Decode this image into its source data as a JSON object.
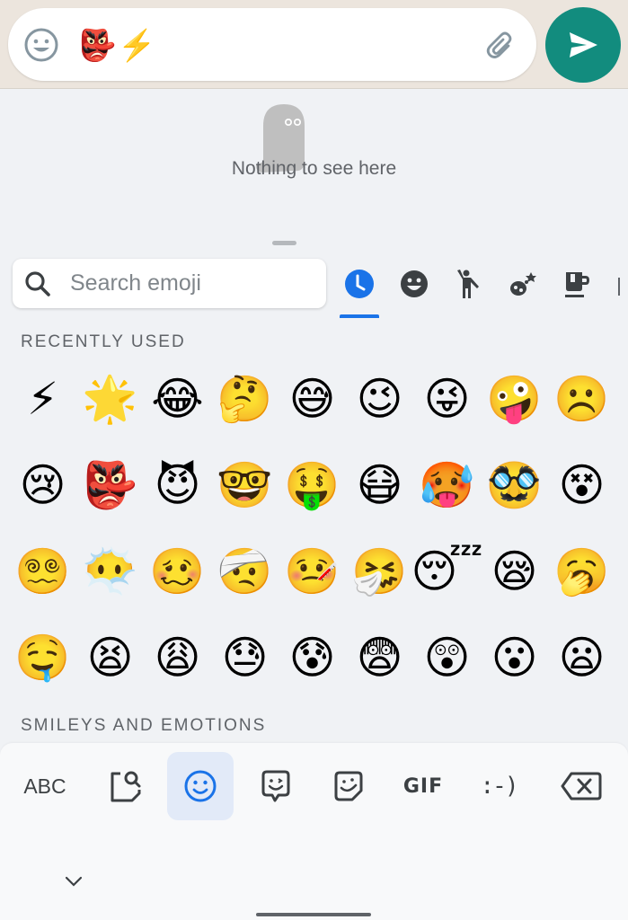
{
  "chat_input": {
    "typed_text": "👺⚡",
    "emoji_toggle_icon": "smiley-outline-icon",
    "attach_icon": "paperclip-icon",
    "send_icon": "send-arrow-icon",
    "send_color": "#128c7e"
  },
  "empty_state": {
    "icon": "ghost-icon",
    "message": "Nothing to see here"
  },
  "search": {
    "placeholder": "Search emoji",
    "value": ""
  },
  "category_tabs": [
    {
      "name": "recent",
      "icon": "clock-icon",
      "active": true
    },
    {
      "name": "smileys",
      "icon": "smiley-icon",
      "active": false
    },
    {
      "name": "people",
      "icon": "person-waving-icon",
      "active": false
    },
    {
      "name": "animals-nature",
      "icon": "bug-flower-icon",
      "active": false
    },
    {
      "name": "food-drink",
      "icon": "cup-icon",
      "active": false
    }
  ],
  "accent_color": "#1a73e8",
  "sections": {
    "recent_title": "RECENTLY USED",
    "smileys_title": "SMILEYS AND EMOTIONS"
  },
  "recent_emojis": [
    [
      "⚡",
      "🌟",
      "😂",
      "🤔",
      "😅",
      "😉",
      "😜",
      "🤪",
      "☹️"
    ],
    [
      "😢",
      "👺",
      "😈",
      "🤓",
      "🤑",
      "😷",
      "🥵",
      "🥸",
      "😵"
    ],
    [
      "😵‍💫",
      "😶‍🌫️",
      "🥴",
      "🤕",
      "🤒",
      "🤧",
      "😴",
      "😪",
      "🥱"
    ],
    [
      "🤤",
      "😫",
      "😩",
      "😓",
      "😰",
      "😨",
      "😲",
      "😮",
      "😦"
    ]
  ],
  "keyboard_bar": {
    "abc_label": "ABC",
    "emoji_search_icon": "sticker-search-icon",
    "emoji_icon": "smiley-outline-icon",
    "bitmoji_icon": "speech-smiley-icon",
    "sticker_icon": "sticker-icon",
    "gif_label": "GIF",
    "emoticon_label": ":-)",
    "backspace_icon": "backspace-icon",
    "collapse_icon": "chevron-down-icon"
  }
}
